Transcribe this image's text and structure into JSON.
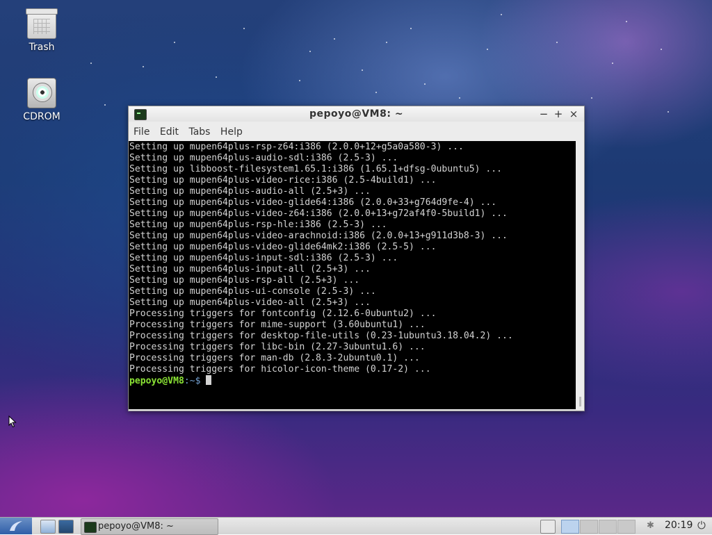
{
  "desktop": {
    "icons": [
      {
        "label": "Trash",
        "icon": "trash-icon"
      },
      {
        "label": "CDROM",
        "icon": "cdrom-icon"
      }
    ]
  },
  "window": {
    "title": "pepoyo@VM8: ~",
    "controls": {
      "minimize": "−",
      "maximize": "+",
      "close": "×"
    },
    "menu": {
      "file": "File",
      "edit": "Edit",
      "tabs": "Tabs",
      "help": "Help"
    }
  },
  "terminal": {
    "lines": [
      "Setting up mupen64plus-rsp-z64:i386 (2.0.0+12+g5a0a580-3) ...",
      "Setting up mupen64plus-audio-sdl:i386 (2.5-3) ...",
      "Setting up libboost-filesystem1.65.1:i386 (1.65.1+dfsg-0ubuntu5) ...",
      "Setting up mupen64plus-video-rice:i386 (2.5-4build1) ...",
      "Setting up mupen64plus-audio-all (2.5+3) ...",
      "Setting up mupen64plus-video-glide64:i386 (2.0.0+33+g764d9fe-4) ...",
      "Setting up mupen64plus-video-z64:i386 (2.0.0+13+g72af4f0-5build1) ...",
      "Setting up mupen64plus-rsp-hle:i386 (2.5-3) ...",
      "Setting up mupen64plus-video-arachnoid:i386 (2.0.0+13+g911d3b8-3) ...",
      "Setting up mupen64plus-video-glide64mk2:i386 (2.5-5) ...",
      "Setting up mupen64plus-input-sdl:i386 (2.5-3) ...",
      "Setting up mupen64plus-input-all (2.5+3) ...",
      "Setting up mupen64plus-rsp-all (2.5+3) ...",
      "Setting up mupen64plus-ui-console (2.5-3) ...",
      "Setting up mupen64plus-video-all (2.5+3) ...",
      "Processing triggers for fontconfig (2.12.6-0ubuntu2) ...",
      "Processing triggers for mime-support (3.60ubuntu1) ...",
      "Processing triggers for desktop-file-utils (0.23-1ubuntu3.18.04.2) ...",
      "Processing triggers for libc-bin (2.27-3ubuntu1.6) ...",
      "Processing triggers for man-db (2.8.3-2ubuntu0.1) ...",
      "Processing triggers for hicolor-icon-theme (0.17-2) ..."
    ],
    "prompt_user": "pepoyo@VM8",
    "prompt_path": ":~$ ",
    "colors": {
      "background": "#000000",
      "text": "#d3d3d3",
      "user": "#8ae234",
      "path": "#729fcf"
    }
  },
  "taskbar": {
    "task_label": "pepoyo@VM8: ~",
    "clock": "20:19",
    "icons": [
      "start-menu-icon",
      "file-manager-icon",
      "preferences-icon",
      "bluetooth-icon",
      "power-icon"
    ]
  }
}
